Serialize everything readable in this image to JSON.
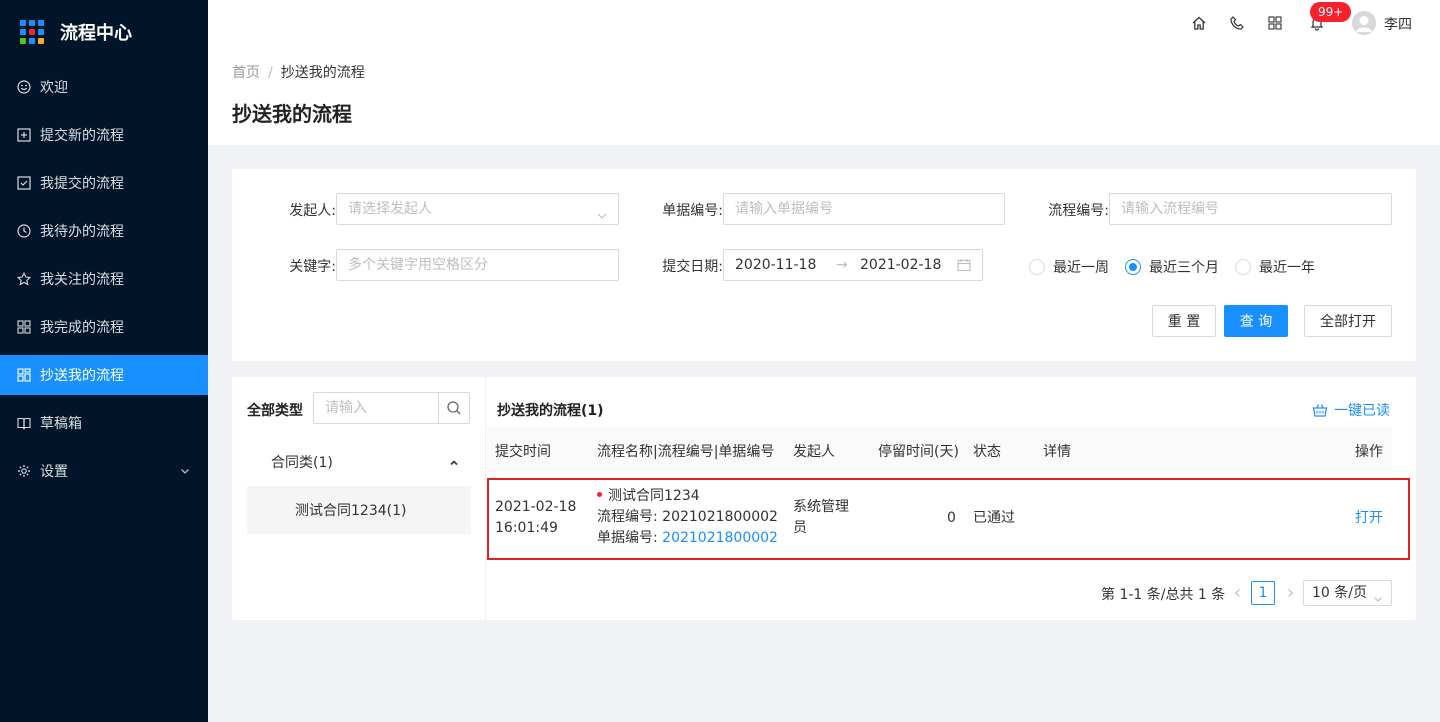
{
  "colors": {
    "sidebar_bg": "#001529",
    "accent": "#1890ff",
    "danger": "#f5222d",
    "highlight_border": "#e02020"
  },
  "sidebar": {
    "app_title": "流程中心",
    "items": [
      {
        "label": "欢迎",
        "icon": "smile-icon"
      },
      {
        "label": "提交新的流程",
        "icon": "plus-square-icon"
      },
      {
        "label": "我提交的流程",
        "icon": "check-square-icon"
      },
      {
        "label": "我待办的流程",
        "icon": "clock-icon"
      },
      {
        "label": "我关注的流程",
        "icon": "star-icon"
      },
      {
        "label": "我完成的流程",
        "icon": "appstore-icon"
      },
      {
        "label": "抄送我的流程",
        "icon": "cc-icon",
        "active": true
      },
      {
        "label": "草稿箱",
        "icon": "book-icon"
      },
      {
        "label": "设置",
        "icon": "setting-icon"
      }
    ]
  },
  "header": {
    "badge": "99+",
    "username": "李四"
  },
  "breadcrumb": {
    "home": "首页",
    "sep": "/",
    "current": "抄送我的流程"
  },
  "page_title": "抄送我的流程",
  "filters": {
    "initiator_label": "发起人:",
    "initiator_placeholder": "请选择发起人",
    "doc_no_label": "单据编号:",
    "doc_no_placeholder": "请输入单据编号",
    "flow_no_label": "流程编号:",
    "flow_no_placeholder": "请输入流程编号",
    "keyword_label": "关键字:",
    "keyword_placeholder": "多个关键字用空格区分",
    "date_label": "提交日期:",
    "date_start": "2020-11-18",
    "date_arrow": "→",
    "date_end": "2021-02-18",
    "ranges": [
      {
        "label": "最近一周",
        "checked": false
      },
      {
        "label": "最近三个月",
        "checked": true
      },
      {
        "label": "最近一年",
        "checked": false
      }
    ],
    "reset_label": "重 置",
    "query_label": "查 询",
    "open_all_label": "全部打开"
  },
  "left_panel": {
    "title": "全部类型",
    "search_placeholder": "请输入",
    "tree_parent": "合同类(1)",
    "tree_child": "测试合同1234(1)"
  },
  "table": {
    "title": "抄送我的流程(1)",
    "mark_all_read": "一键已读",
    "columns": [
      "提交时间",
      "流程名称|流程编号|单据编号",
      "发起人",
      "停留时间(天)",
      "状态",
      "详情",
      "操作"
    ],
    "rows": [
      {
        "date": "2021-02-18",
        "time": "16:01:49",
        "name": "测试合同1234",
        "flow_no": "流程编号: 2021021800002",
        "doc_no_label": "单据编号: ",
        "doc_no": "2021021800002",
        "initiator_line1": "系统管理",
        "initiator_line2": "员",
        "stay_days": "0",
        "status": "已通过",
        "detail": "",
        "action": "打开"
      }
    ]
  },
  "pagination": {
    "total_text": "第 1-1 条/总共 1 条",
    "current_page": "1",
    "page_size": "10 条/页"
  }
}
